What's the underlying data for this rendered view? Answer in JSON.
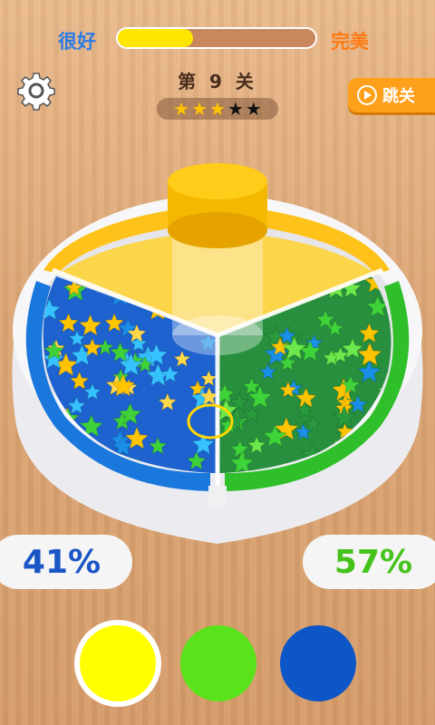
{
  "progress": {
    "left_label": "很好",
    "right_label": "完美",
    "fill_fraction": 0.38,
    "fill_color": "#ffe600"
  },
  "level": {
    "label": "第 9 关",
    "stars_earned": 3,
    "stars_total": 5
  },
  "settings": {
    "icon": "gear-icon"
  },
  "skip": {
    "label": "跳关",
    "icon": "play-circle-icon"
  },
  "scores": {
    "left_percent": "41%",
    "right_percent": "57%",
    "left_color": "#1a56c6",
    "right_color": "#46c31a"
  },
  "color_choices": [
    {
      "name": "yellow",
      "color": "#ffff00",
      "selected": true
    },
    {
      "name": "green",
      "color": "#59e31a",
      "selected": false
    },
    {
      "name": "blue",
      "color": "#0c56c7",
      "selected": false
    }
  ]
}
